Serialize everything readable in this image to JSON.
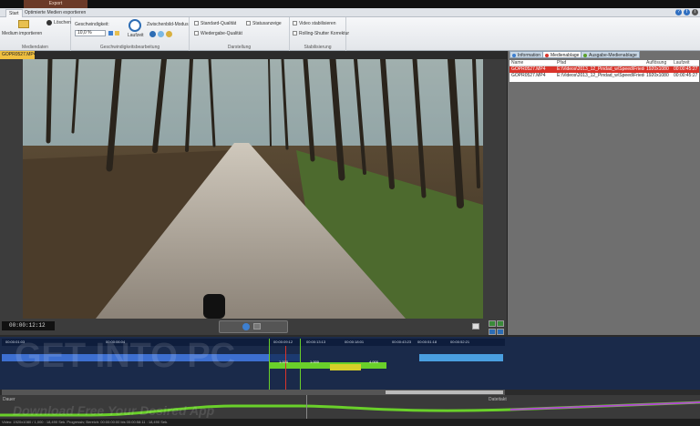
{
  "window": {
    "context_tab": "Export",
    "tabs": [
      {
        "label": "Start"
      },
      {
        "label": "Optimierte Medien exportieren"
      }
    ]
  },
  "ribbon": {
    "import_label": "Medium importieren",
    "delete_label": "Löschen",
    "group_media": "Mediendaten",
    "speed_label": "Geschwindigkeit:",
    "speed_value": "10,0 %",
    "run_label": "Laufzeit",
    "intermediate_label": "Zwischenbild-Modus",
    "group_speed": "Geschwindigkeitsbearbeitung",
    "standard_quality": "Standard-Qualität",
    "status_display": "Statusanzeige",
    "playback_quality": "Wiedergabe-Qualität",
    "group_display": "Darstellung",
    "video_stabilize": "Video stabilisieren",
    "rolling_shutter": "Rolling-Shutter Korrektur",
    "group_stabilize": "Stabilisierung"
  },
  "file_tab": "GOPR0527.MP4",
  "right_panel": {
    "tabs": [
      "Information",
      "Medienablage",
      "Ausgabe-Medienablage"
    ],
    "columns": [
      "Name",
      "Pfad",
      "Auflösung",
      "Laufzeit"
    ],
    "rows": [
      [
        "GOPR0527.MP4",
        "E:\\Videos\\2013_12_Pindad_w\\Speed\\Frieden3...",
        "1920x1080",
        "00:00:45:27"
      ],
      [
        "GOPR0527.MP4",
        "E:\\Videos\\2013_12_Pindad_w\\Speed\\Frieden3...",
        "1920x1080",
        "00:00:45:27"
      ]
    ]
  },
  "transport": {
    "timecode": "00:00:12:12"
  },
  "timeline": {
    "ticks": [
      "00:00:01:03",
      "00:00:06:04",
      "00:00:09:12",
      "00:00:13:13",
      "00:00:18:01",
      "00:00:43:23",
      "00:00:51:18",
      "00:00:52:21"
    ],
    "segment_labels": [
      "1.000",
      "1.000",
      "4.000"
    ],
    "track_colors": [
      "#2d5fbf",
      "#4a8fe0",
      "#6ad02a",
      "#d8d028",
      "#4a9fe0"
    ]
  },
  "lower": {
    "left_label": "Dauer",
    "right_label": "Dateitakt"
  },
  "status": {
    "text": "Video: 1920x1080 / 1,000 : 18,490 Sek. Progressiv; Bereich: 00:00:00:00 bis 00:00:58:11 : 18,490 Sek."
  },
  "watermark": {
    "line1": "GET INTO PC",
    "line2": "Download Free Your Desired App"
  },
  "colors": {
    "accent": "#2d6db4",
    "context_tab": "#6b3a28",
    "file_tab": "#f0c040",
    "selected_row": "#d9342b"
  }
}
